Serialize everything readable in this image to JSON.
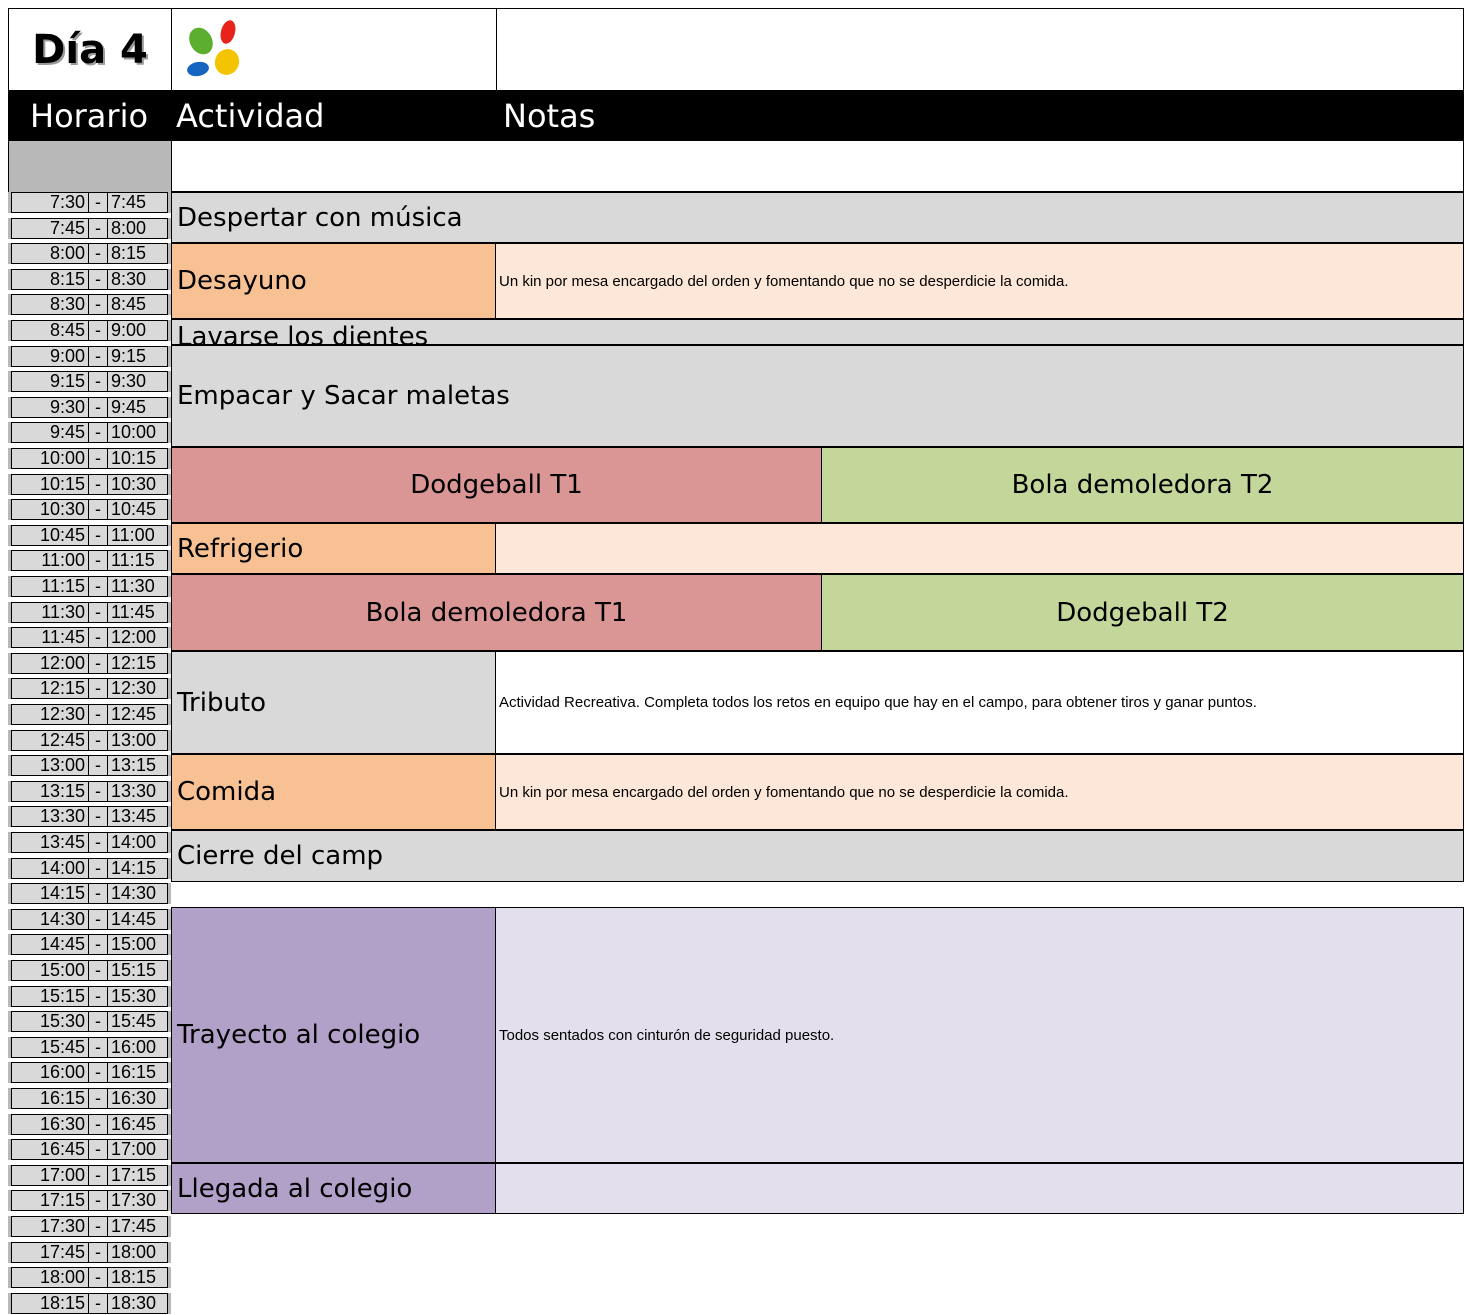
{
  "title": "Día 4",
  "logo": "colorful-petals-logo",
  "colors": {
    "header_bar": "#000000",
    "time_cell": "#d9d9d9",
    "gray_activity": "#d9d9d9",
    "meal": "#f8c193",
    "meal_note": "#fce7d8",
    "team1": "#da9694",
    "team2": "#c4d79b",
    "travel": "#b1a0c7",
    "travel_note": "#e3dfed"
  },
  "headers": {
    "horario": "Horario",
    "actividad": "Actividad",
    "notas": "Notas"
  },
  "times": [
    [
      "7:30",
      "7:45"
    ],
    [
      "7:45",
      "8:00"
    ],
    [
      "8:00",
      "8:15"
    ],
    [
      "8:15",
      "8:30"
    ],
    [
      "8:30",
      "8:45"
    ],
    [
      "8:45",
      "9:00"
    ],
    [
      "9:00",
      "9:15"
    ],
    [
      "9:15",
      "9:30"
    ],
    [
      "9:30",
      "9:45"
    ],
    [
      "9:45",
      "10:00"
    ],
    [
      "10:00",
      "10:15"
    ],
    [
      "10:15",
      "10:30"
    ],
    [
      "10:30",
      "10:45"
    ],
    [
      "10:45",
      "11:00"
    ],
    [
      "11:00",
      "11:15"
    ],
    [
      "11:15",
      "11:30"
    ],
    [
      "11:30",
      "11:45"
    ],
    [
      "11:45",
      "12:00"
    ],
    [
      "12:00",
      "12:15"
    ],
    [
      "12:15",
      "12:30"
    ],
    [
      "12:30",
      "12:45"
    ],
    [
      "12:45",
      "13:00"
    ],
    [
      "13:00",
      "13:15"
    ],
    [
      "13:15",
      "13:30"
    ],
    [
      "13:30",
      "13:45"
    ],
    [
      "13:45",
      "14:00"
    ],
    [
      "14:00",
      "14:15"
    ],
    [
      "14:15",
      "14:30"
    ],
    [
      "14:30",
      "14:45"
    ],
    [
      "14:45",
      "15:00"
    ],
    [
      "15:00",
      "15:15"
    ],
    [
      "15:15",
      "15:30"
    ],
    [
      "15:30",
      "15:45"
    ],
    [
      "15:45",
      "16:00"
    ],
    [
      "16:00",
      "16:15"
    ],
    [
      "16:15",
      "16:30"
    ],
    [
      "16:30",
      "16:45"
    ],
    [
      "16:45",
      "17:00"
    ],
    [
      "17:00",
      "17:15"
    ],
    [
      "17:15",
      "17:30"
    ],
    [
      "17:30",
      "17:45"
    ],
    [
      "17:45",
      "18:00"
    ],
    [
      "18:00",
      "18:15"
    ],
    [
      "18:15",
      "18:30"
    ]
  ],
  "time_separator": "-",
  "activities": {
    "despertar": "Despertar con música",
    "desayuno": "Desayuno",
    "desayuno_note": "Un kin por mesa encargado del orden y fomentando que no se desperdicie la comida.",
    "dientes": "Lavarse los dientes",
    "empacar": "Empacar y Sacar maletas",
    "dodgeball_t1": "Dodgeball T1",
    "bola_t2": "Bola demoledora T2",
    "refrigerio": "Refrigerio",
    "bola_t1": "Bola demoledora T1",
    "dodgeball_t2": "Dodgeball T2",
    "tributo": "Tributo",
    "tributo_note": "Actividad Recreativa. Completa todos los retos en equipo que hay en el campo, para obtener tiros y ganar puntos.",
    "comida": "Comida",
    "comida_note": "Un kin por mesa encargado del orden y fomentando que no se desperdicie la comida.",
    "cierre": "Cierre del camp",
    "trayecto": "Trayecto al colegio",
    "trayecto_note": "Todos sentados con cinturón de seguridad puesto.",
    "llegada": "Llegada al colegio"
  }
}
